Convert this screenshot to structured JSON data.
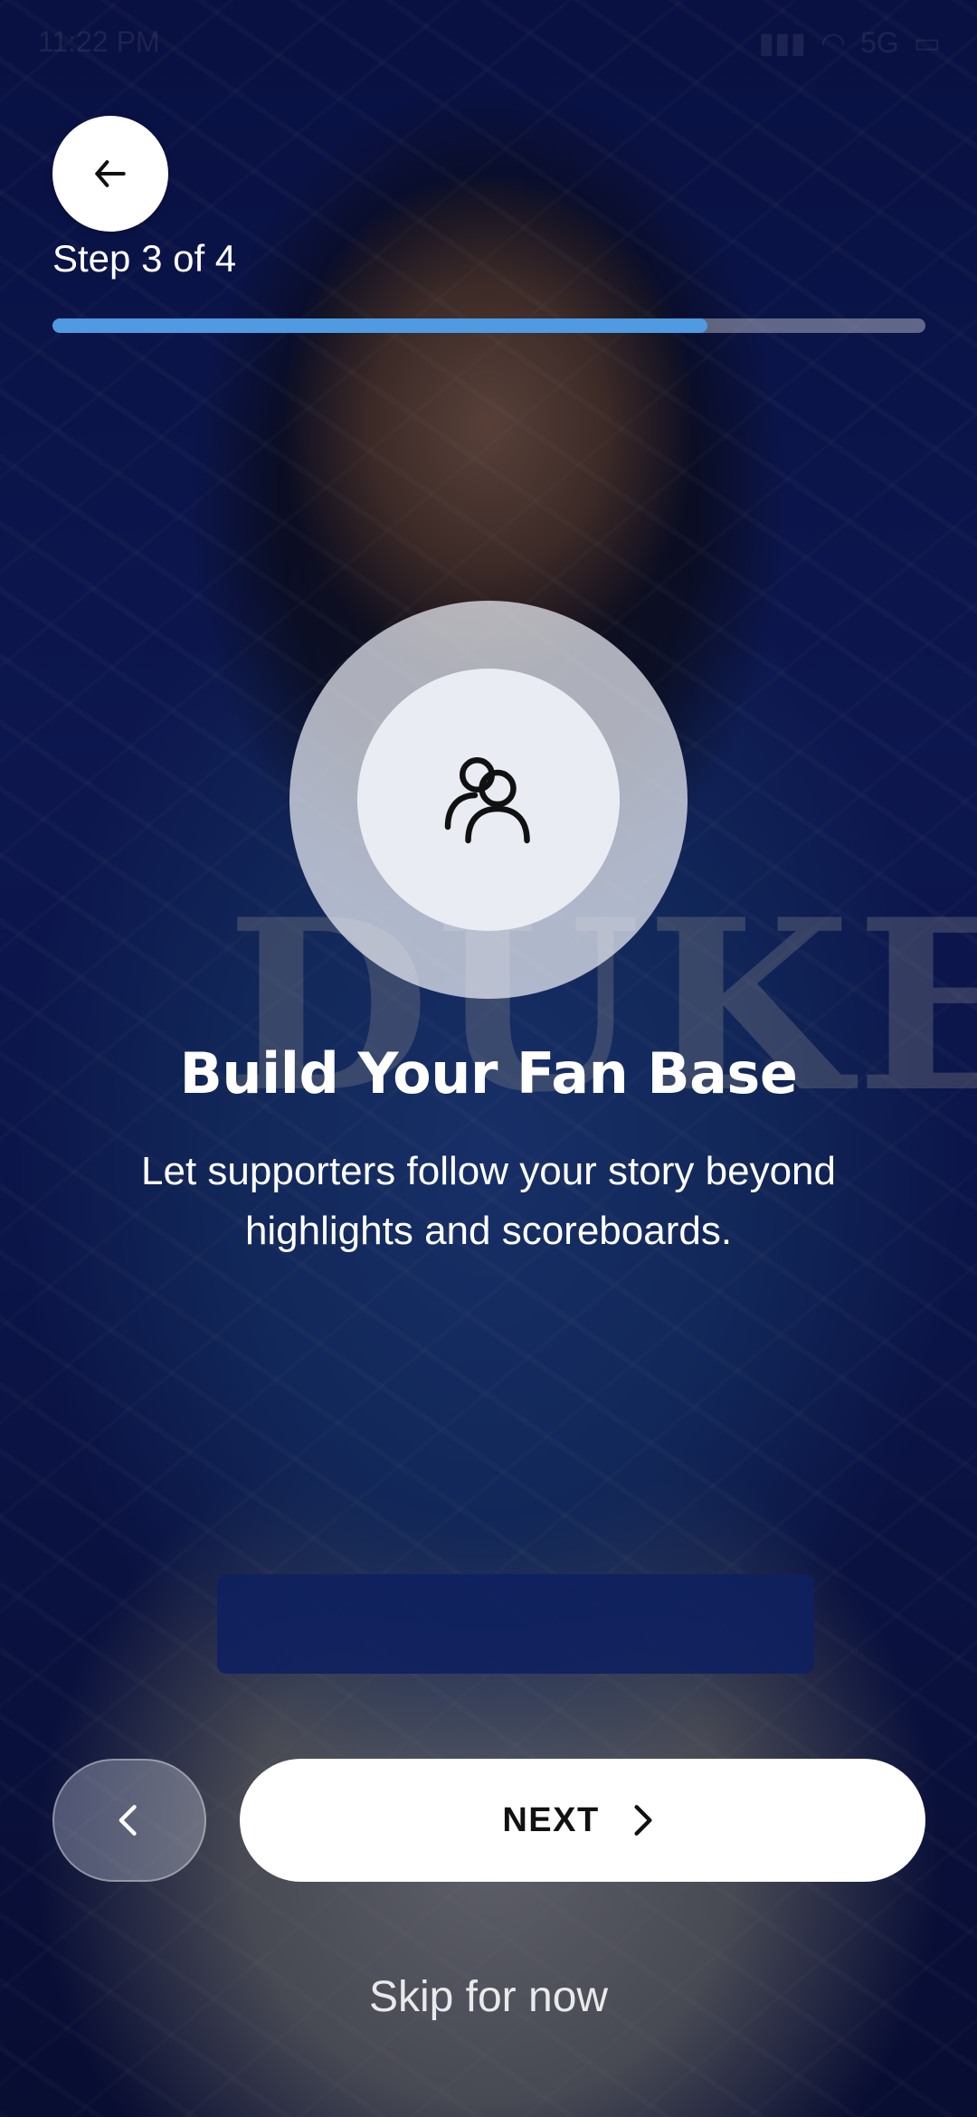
{
  "status_bar": {
    "time": "11:22 PM",
    "network": "5G",
    "icons": [
      "signal-icon",
      "wifi-icon",
      "battery-icon"
    ]
  },
  "header": {
    "back_icon": "arrow-left-icon",
    "step_label": "Step 3 of 4",
    "progress": 0.75
  },
  "feature": {
    "icon": "users-icon",
    "title": "Build Your Fan Base",
    "description": "Let supporters follow your story beyond highlights and scoreboards."
  },
  "controls": {
    "prev_icon": "chevron-left-icon",
    "next_label": "NEXT",
    "next_icon": "chevron-right-icon",
    "skip_label": "Skip for now"
  },
  "colors": {
    "progress_fill": "#4f9ae0",
    "progress_track": "#c8cdd7",
    "button_bg": "#ffffff",
    "text": "#ffffff"
  }
}
